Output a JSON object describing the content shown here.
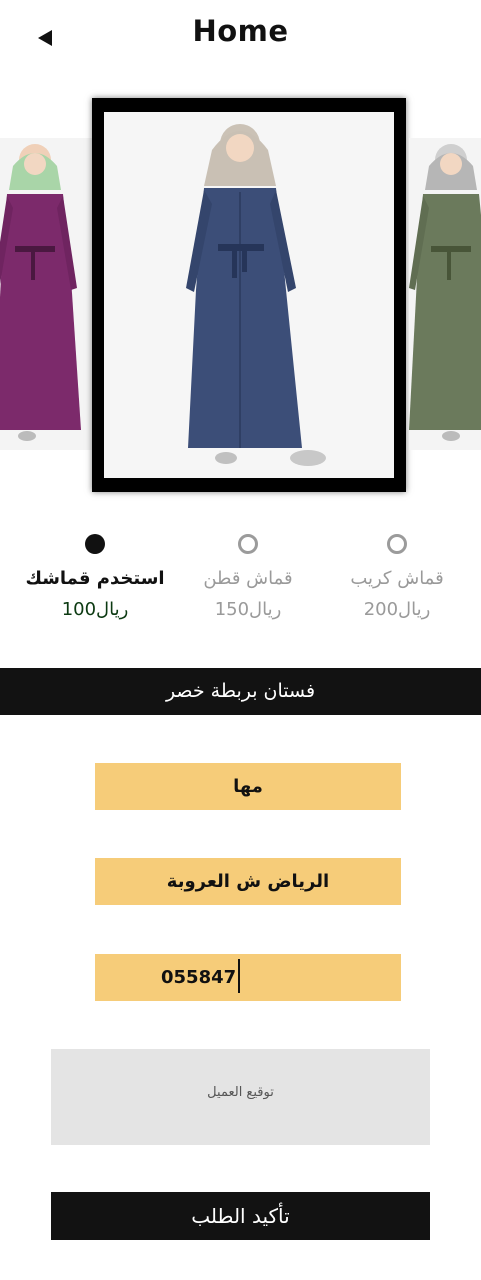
{
  "header": {
    "title": "Home",
    "back_icon": "back-arrow-icon"
  },
  "carousel": {
    "items": [
      {
        "color_name": "purple",
        "dress_color": "#7c2a6b",
        "scarf_color": "#a9d5a8"
      },
      {
        "color_name": "navy",
        "dress_color": "#3c4e78",
        "scarf_color": "#c9c0b4"
      },
      {
        "color_name": "olive",
        "dress_color": "#6b7a5c",
        "scarf_color": "#b6b6b6"
      }
    ]
  },
  "fabric_options": [
    {
      "name": "استخدم قماشك",
      "price_value": "100",
      "currency": "ريال",
      "selected": true
    },
    {
      "name": "قماش قطن",
      "price_value": "150",
      "currency": "ريال",
      "selected": false
    },
    {
      "name": "قماش كريب",
      "price_value": "200",
      "currency": "ريال",
      "selected": false
    }
  ],
  "product": {
    "name": "فستان بربطة خصر"
  },
  "form": {
    "name_value": "مها",
    "address_value": "الرياض ش العروبة",
    "phone_value": "055847",
    "signature_placeholder": "توقيع العميل"
  },
  "actions": {
    "confirm_label": "تأكيد الطلب"
  },
  "colors": {
    "field_bg": "#f6cc79",
    "bar_bg": "#121212",
    "signature_bg": "#e4e4e4",
    "selected_price": "#0c3a12",
    "inactive_text": "#9a9a9a"
  }
}
